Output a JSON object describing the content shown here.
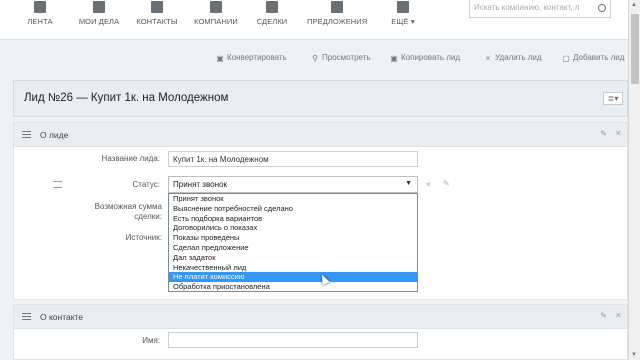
{
  "nav": {
    "items": [
      {
        "label": "ЛЕНТА"
      },
      {
        "label": "МОИ ДЕЛА"
      },
      {
        "label": "КОНТАКТЫ"
      },
      {
        "label": "КОМПАНИИ"
      },
      {
        "label": "СДЕЛКИ"
      },
      {
        "label": "ПРЕДЛОЖЕНИЯ"
      },
      {
        "label": "ЕЩЁ ▾"
      }
    ],
    "search_placeholder": "Искать компанию, контакт, л"
  },
  "actions": {
    "convert": "Конвертировать",
    "view": "Просмотреть",
    "copy": "Копировать лид",
    "delete": "Удалить лид",
    "add": "Добавить лид"
  },
  "title": "Лид №26 — Купит 1к. на Молодежном",
  "section_about": {
    "title": "О лиде",
    "name_label": "Название лида:",
    "name_value": "Купит 1к. на Молодежном",
    "status_label": "Статус:",
    "status_value": "Принят звонок",
    "amount_label": "Возможная сумма сделки:",
    "source_label": "Источник:"
  },
  "status_options": [
    "Принят звонок",
    "Выяснение потребностей сделано",
    "Есть подборка вариантов",
    "Договорились о показах",
    "Показы проведены",
    "Сделал предложение",
    "Дал задаток",
    "Некачественный лид",
    "Не платит комиссию",
    "Обработка приостановлена"
  ],
  "selected_option_index": 8,
  "section_contact": {
    "title": "О контакте",
    "name_label": "Имя:"
  }
}
